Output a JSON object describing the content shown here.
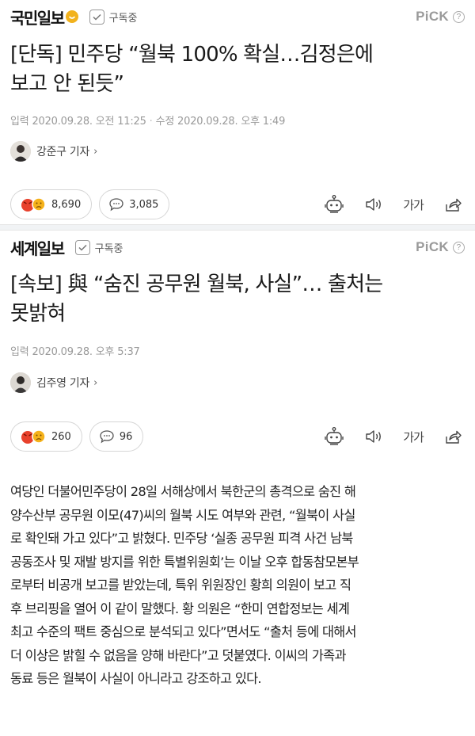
{
  "articles": [
    {
      "press": "국민일보",
      "subscribe_label": "구독중",
      "pick_label": "PiCK",
      "headline_lines": [
        "[단독] 민주당 “월북 100% 확실…김정은에",
        "보고 안 된듯”"
      ],
      "input_time": "입력 2020.09.28. 오전 11:25",
      "modified_time": "수정 2020.09.28. 오후 1:49",
      "reporter": "강준구 기자",
      "reaction_count": "8,690",
      "comment_count": "3,085",
      "font_size_label": "가가"
    },
    {
      "press": "세계일보",
      "subscribe_label": "구독중",
      "pick_label": "PiCK",
      "headline_lines": [
        "[속보] 與 “숨진 공무원 월북, 사실”… 출처는",
        "못밝혀"
      ],
      "input_time": "입력 2020.09.28. 오후 5:37",
      "reporter": "김주영 기자",
      "reaction_count": "260",
      "comment_count": "96",
      "font_size_label": "가가"
    }
  ],
  "body_lines": [
    "여당인 더불어민주당이 28일 서해상에서 북한군의 총격으로 숨진 해",
    "양수산부 공무원 이모(47)씨의 월북 시도 여부와 관련, “월북이 사실",
    "로 확인돼 가고 있다”고 밝혔다. 민주당 ‘실종 공무원 피격 사건 남북",
    "공동조사 및 재발 방지를 위한 특별위원회’는 이날 오후 합동참모본부",
    "로부터 비공개 보고를 받았는데, 특위 위원장인 황희 의원이 보고 직",
    "후 브리핑을 열어 이 같이 말했다. 황 의원은 “한미 연합정보는 세계",
    "최고 수준의 팩트 중심으로 분석되고 있다”면서도 “출처 등에 대해서",
    "더 이상은 밝힐 수 없음을 양해 바란다”고 덧붙였다. 이씨의 가족과",
    "동료 등은 월북이 사실이 아니라고 강조하고 있다."
  ],
  "colors": {
    "text": "#222222",
    "meta": "#999999",
    "pick": "#9a9a9a",
    "angry_emoji": "#e8412c",
    "sad_emoji": "#f5b21b",
    "separator": "#f1f3f5"
  },
  "icons": [
    "emoji-check-icon",
    "checkbox-icon",
    "help-icon",
    "angry-face-icon",
    "sad-face-icon",
    "comment-bubble-icon",
    "robot-summary-icon",
    "speaker-icon",
    "share-icon",
    "chevron-right-icon"
  ]
}
